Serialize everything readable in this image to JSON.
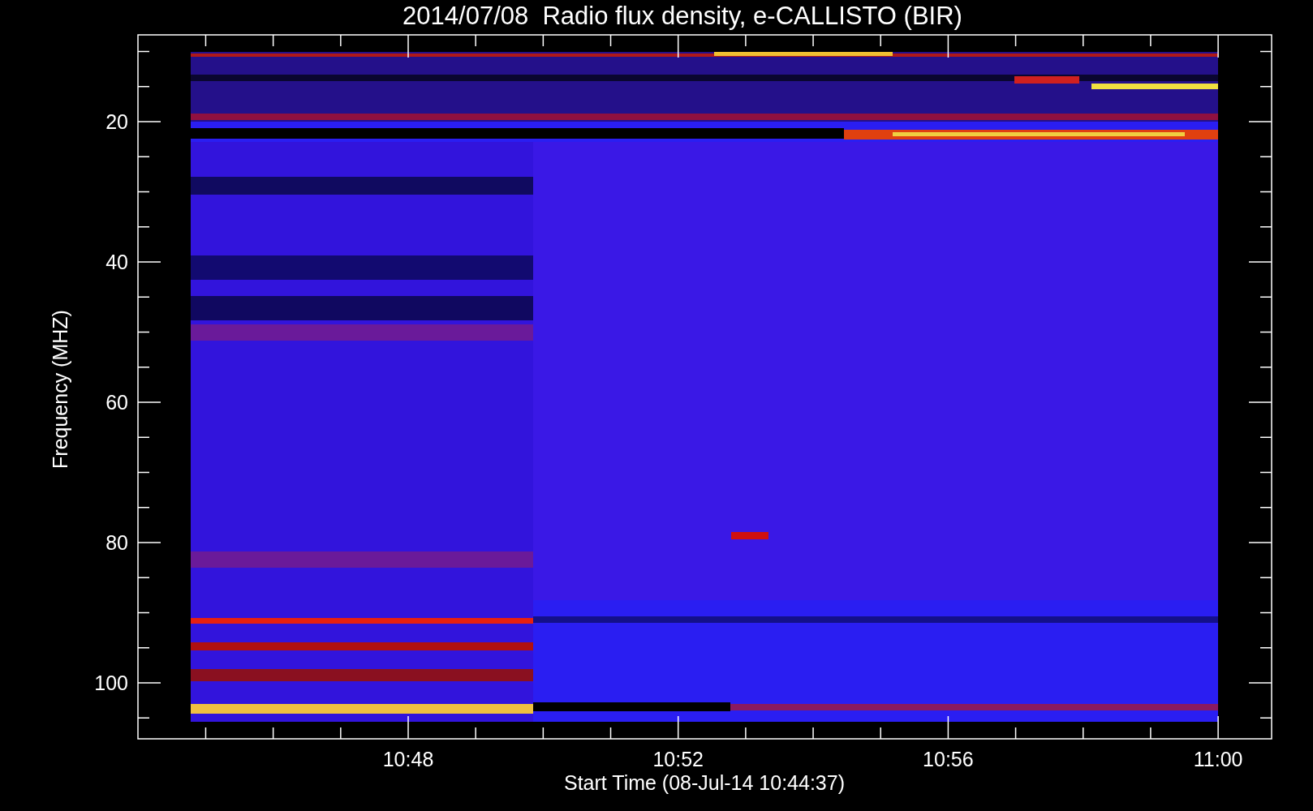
{
  "title": "2014/07/08  Radio flux density, e-CALLISTO (BIR)",
  "y_axis": {
    "label": "Frequency (MHZ)",
    "ticks": [
      "20",
      "40",
      "60",
      "80",
      "100"
    ]
  },
  "x_axis": {
    "label": "Start Time (08-Jul-14 10:44:37)",
    "ticks": [
      "10:48",
      "10:52",
      "10:56",
      "11:00"
    ]
  }
}
